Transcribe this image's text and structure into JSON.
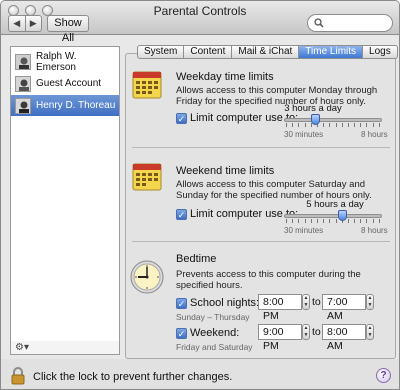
{
  "window": {
    "title": "Parental Controls"
  },
  "toolbar": {
    "back_label": "◀",
    "forward_label": "▶",
    "show_all_label": "Show All",
    "search_placeholder": ""
  },
  "sidebar": {
    "users": [
      {
        "name": "Ralph W. Emerson",
        "selected": false
      },
      {
        "name": "Guest Account",
        "selected": false
      },
      {
        "name": "Henry D. Thoreau",
        "selected": true
      }
    ],
    "gear_label": "⚙▾"
  },
  "tabs": [
    {
      "label": "System",
      "active": false
    },
    {
      "label": "Content",
      "active": false
    },
    {
      "label": "Mail & iChat",
      "active": false
    },
    {
      "label": "Time Limits",
      "active": true
    },
    {
      "label": "Logs",
      "active": false
    }
  ],
  "weekday": {
    "title": "Weekday time limits",
    "description": "Allows access to this computer Monday through Friday for the specified number of hours only.",
    "checkbox_label": "Limit computer use to:",
    "checked": true,
    "value_label": "3 hours a day",
    "value_fraction": 0.33,
    "min_label": "30 minutes",
    "max_label": "8 hours"
  },
  "weekend": {
    "title": "Weekend time limits",
    "description": "Allows access to this computer Saturday and Sunday for the specified number of hours only.",
    "checkbox_label": "Limit computer use to:",
    "checked": true,
    "value_label": "5 hours a day",
    "value_fraction": 0.6,
    "min_label": "30 minutes",
    "max_label": "8 hours"
  },
  "bedtime": {
    "title": "Bedtime",
    "description": "Prevents access to this computer during the specified hours.",
    "school_nights": {
      "label": "School nights:",
      "sublabel": "Sunday – Thursday",
      "checked": true,
      "from": "8:00 PM",
      "to": "7:00 AM"
    },
    "weekend": {
      "label": "Weekend:",
      "sublabel": "Friday and Saturday",
      "checked": true,
      "from": "9:00 PM",
      "to": "8:00 AM"
    },
    "to_label": "to"
  },
  "footer": {
    "lock_message": "Click the lock to prevent further changes.",
    "help_label": "?"
  },
  "colors": {
    "selection": "#3f6fc3",
    "calendar_red": "#c93a2a",
    "calendar_yellow": "#f3d64c",
    "lock": "#c9952e"
  }
}
